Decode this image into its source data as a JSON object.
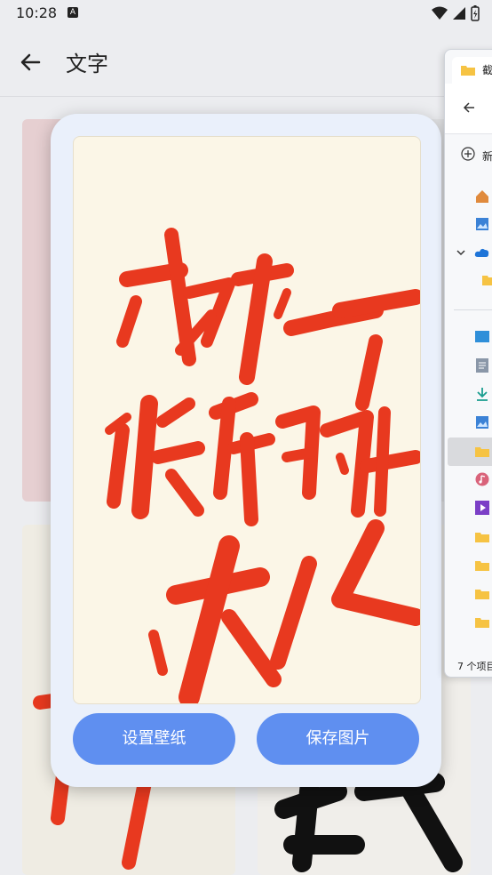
{
  "status_bar": {
    "time": "10:28",
    "a_label": "A"
  },
  "app_bar": {
    "title": "文字"
  },
  "dialog": {
    "preview_text": [
      "成为一个",
      "快乐的",
      "大人"
    ],
    "set_wallpaper_label": "设置壁纸",
    "save_image_label": "保存图片"
  },
  "explorer": {
    "tab_label": "截",
    "new_label": "新",
    "status_text": "7 个项目"
  },
  "colors": {
    "accent": "#5f8ff0",
    "dialog_bg": "#eaf0fb",
    "calligraphy_red": "#e8391f"
  }
}
